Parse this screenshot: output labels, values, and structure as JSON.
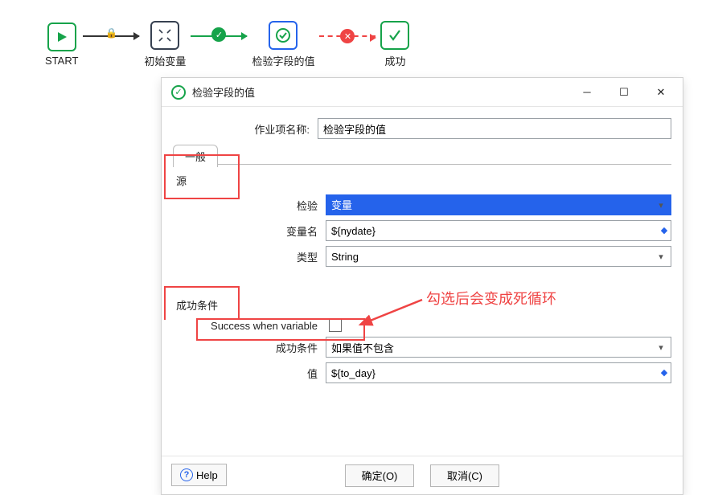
{
  "flow": {
    "start_label": "START",
    "init_label": "初始变量",
    "check_label": "检验字段的值",
    "success_label": "成功"
  },
  "dialog": {
    "title": "检验字段的值",
    "job_name_label": "作业项名称:",
    "job_name_value": "检验字段的值",
    "tab_general": "一般",
    "section_source": "源",
    "check_label": "检验",
    "check_value": "变量",
    "var_name_label": "变量名",
    "var_name_value": "${nydate}",
    "type_label": "类型",
    "type_value": "String",
    "section_conditions": "成功条件",
    "success_when_label": "Success when variable",
    "cond_label": "成功条件",
    "cond_value": "如果值不包含",
    "value_label": "值",
    "value_value": "${to_day}",
    "btn_ok": "确定(O)",
    "btn_cancel": "取消(C)",
    "help": "Help"
  },
  "annotation": {
    "note": "勾选后会变成死循环"
  }
}
